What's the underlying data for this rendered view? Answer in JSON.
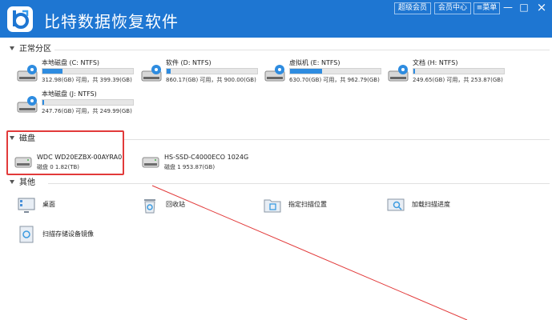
{
  "app": {
    "title": "比特数据恢复软件",
    "buttons": {
      "vip": "超级会员",
      "member_center": "会员中心",
      "menu": "菜单"
    },
    "window_controls": {
      "minimize": "—",
      "maximize": "□",
      "close": "×"
    }
  },
  "sections": {
    "partitions": "正常分区",
    "disks": "磁盘",
    "other": "其他"
  },
  "partitions": [
    {
      "name": "本地磁盘 (C: NTFS)",
      "info": "312.98(GB) 可用，共 399.39(GB)",
      "used": 0.22
    },
    {
      "name": "软件 (D: NTFS)",
      "info": "860.17(GB) 可用，共 900.00(GB)",
      "used": 0.04
    },
    {
      "name": "虚拟机 (E: NTFS)",
      "info": "630.70(GB) 可用，共 962.79(GB)",
      "used": 0.35
    },
    {
      "name": "文档 (H: NTFS)",
      "info": "249.65(GB) 可用，共 253.87(GB)",
      "used": 0.02
    },
    {
      "name": "本地磁盘 (J: NTFS)",
      "info": "247.76(GB) 可用，共 249.99(GB)",
      "used": 0.01
    }
  ],
  "disks": [
    {
      "name": "WDC WD20EZBX-00AYRA0",
      "info": "磁盘 0    1.82(TB)"
    },
    {
      "name": "HS-SSD-C4000ECO 1024G",
      "info": "磁盘 1    953.87(GB)"
    }
  ],
  "tools": {
    "desktop": "桌面",
    "recycle_bin": "回收站",
    "scan_location": "指定扫描位置",
    "load_progress": "加载扫描进度",
    "scan_image": "扫描存储设备镜像"
  },
  "colors": {
    "titlebar": "#1e76d2",
    "bar_fill": "#2e8ce0",
    "highlight": "#e23a3a"
  }
}
